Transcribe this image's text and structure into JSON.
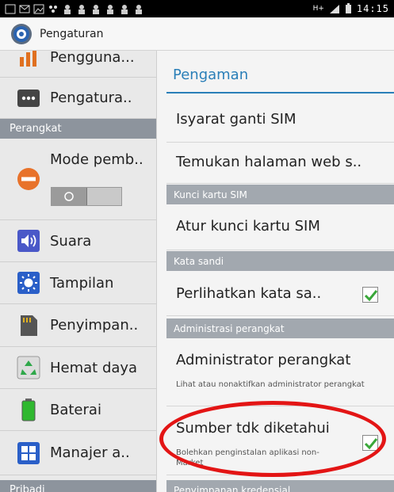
{
  "statusbar": {
    "network_label": "H+",
    "time": "14:15"
  },
  "actionbar": {
    "title": "Pengaturan"
  },
  "left_pane": {
    "items": [
      {
        "label": "Pengguna...",
        "icon": "data-usage-icon"
      },
      {
        "label": "Pengatura..",
        "icon": "more-dots-icon"
      },
      {
        "label": "Mode pemb..",
        "icon": "flight-mode-icon"
      },
      {
        "label": "Suara",
        "icon": "speaker-icon"
      },
      {
        "label": "Tampilan",
        "icon": "brightness-icon"
      },
      {
        "label": "Penyimpan..",
        "icon": "sd-card-icon"
      },
      {
        "label": "Hemat daya",
        "icon": "recycle-icon"
      },
      {
        "label": "Baterai",
        "icon": "battery-icon"
      },
      {
        "label": "Manajer a..",
        "icon": "app-grid-icon"
      }
    ],
    "header_perangkat": "Perangkat",
    "header_pribadi": "Pribadi"
  },
  "right_pane": {
    "title": "Pengaman",
    "isyarat_label": "Isyarat ganti SIM",
    "temukan_label": "Temukan halaman web s..",
    "header_kunci": "Kunci kartu SIM",
    "atur_label": "Atur kunci kartu SIM",
    "header_kata_sandi": "Kata sandi",
    "perlihatkan_label": "Perlihatkan kata sa..",
    "perlihatkan_checked": true,
    "header_admin": "Administrasi perangkat",
    "admin_label": "Administrator perangkat",
    "admin_sub": "Lihat atau nonaktifkan administrator perangkat",
    "sumber_label": "Sumber tdk diketahui",
    "sumber_sub": "Bolehkan penginstalan aplikasi non-Market",
    "sumber_checked": true,
    "header_penyimpanan": "Penyimpanan kredensial"
  },
  "colors": {
    "accent_blue": "#2a7fb8",
    "highlight_red": "#e31515",
    "check_green": "#3aa83a"
  }
}
